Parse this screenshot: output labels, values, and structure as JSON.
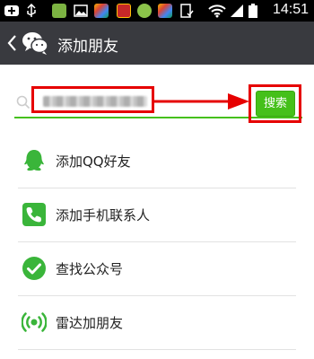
{
  "status_bar": {
    "time": "14:51",
    "icons": [
      "notification-icon",
      "usb-icon",
      "app-icon",
      "image-icon",
      "app-icon",
      "app-icon",
      "app-icon",
      "app-icon",
      "checklist-icon",
      "wifi-icon",
      "signal-icon",
      "battery-icon"
    ]
  },
  "header": {
    "back_icon": "chevron-left-icon",
    "logo_icon": "wechat-logo-icon",
    "title": "添加朋友"
  },
  "search": {
    "value": "",
    "placeholder": "",
    "button_label": "搜索",
    "accent_color": "#45c01a",
    "annotation_color": "#e60000"
  },
  "menu": {
    "items": [
      {
        "icon": "qq-icon",
        "label": "添加QQ好友"
      },
      {
        "icon": "phone-icon",
        "label": "添加手机联系人"
      },
      {
        "icon": "check-circle-icon",
        "label": "查找公众号"
      },
      {
        "icon": "radar-icon",
        "label": "雷达加朋友"
      }
    ]
  }
}
